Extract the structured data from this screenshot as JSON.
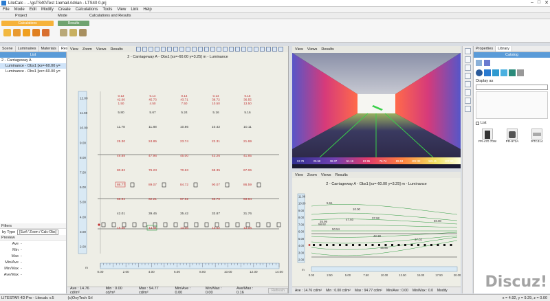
{
  "window": {
    "title": "LiteCalc - ...\\gsTS40\\Test 1\\email Adrian - LTS40 0.prj",
    "min": "–",
    "max": "□",
    "close": "✕"
  },
  "menu": [
    "File",
    "Mode",
    "Edit",
    "Modify",
    "Create",
    "Calculations",
    "Tools",
    "View",
    "Link",
    "Help"
  ],
  "ribbon_tabs": {
    "project": "Project",
    "mode": "Mode",
    "calc": "Calculations and Results"
  },
  "ribbon_groups": {
    "calculations": "Calculations",
    "results": "Results"
  },
  "left_panel": {
    "tabs": [
      "Scene",
      "Luminaires",
      "Materials",
      "Results"
    ],
    "list_header": "List",
    "tree": [
      "2 - Carriageway A",
      "Luminance - Obs1 [xs=-60.00 y=",
      "Luminance - Obs1 [xs=-60.00 y="
    ],
    "filters_title": "Filters",
    "filter_label": "by Type",
    "filter_value": "[Surf / Zoom / Calc-Obs]",
    "preview_title": "Preview",
    "preview_rows": [
      {
        "k": "Ave",
        "v": "-"
      },
      {
        "k": "Min",
        "v": "-"
      },
      {
        "k": "Max",
        "v": "-"
      },
      {
        "k": "Min/Ave",
        "v": "-"
      },
      {
        "k": "Min/Max",
        "v": "-"
      },
      {
        "k": "Ave/Max",
        "v": "-"
      }
    ]
  },
  "mid_pane": {
    "menu": [
      "View",
      "Zoom",
      "Views",
      "Results"
    ],
    "title": "2 - Carriageway A - Obs1 [xs=-60.00 y=3.25] m - Luminance",
    "y_axis": [
      "12.00",
      "11.00",
      "10.00",
      "9.00",
      "8.00",
      "7.00",
      "6.00",
      "5.00",
      "4.00",
      "3.00",
      "2.00"
    ],
    "x_axis": [
      "0.00",
      "2.00",
      "4.00",
      "6.00",
      "8.00",
      "10.00",
      "12.00",
      "14.00"
    ],
    "x_unit": "m",
    "column_heads": [
      [
        "0.13",
        "42.60",
        "1.50"
      ],
      [
        "0.14",
        "45.73",
        "4.50"
      ],
      [
        "0.14",
        "43.71",
        "7.50"
      ],
      [
        "0.14",
        "38.72",
        "10.50"
      ],
      [
        "0.15",
        "36.55",
        "13.50"
      ]
    ],
    "rows": [
      {
        "c": "#333",
        "v": [
          "5.80",
          "5.67",
          "5.24",
          "5.16",
          "5.16"
        ]
      },
      {
        "c": "#333",
        "v": [
          "11.78",
          "11.88",
          "10.86",
          "10.42",
          "10.11"
        ]
      },
      {
        "c": "#c03030",
        "v": [
          "25.30",
          "24.85",
          "23.74",
          "22.31",
          "21.69"
        ]
      },
      {
        "c": "#c03030",
        "v": [
          "49.88",
          "47.96",
          "45.00",
          "43.26",
          "41.85"
        ]
      },
      {
        "c": "#c03030",
        "v": [
          "80.82",
          "76.23",
          "70.63",
          "68.35",
          "67.06"
        ]
      },
      {
        "c": "#c03030",
        "v": [
          "86.77",
          "89.07",
          "84.72",
          "90.07",
          "86.59"
        ]
      },
      {
        "c": "#c03030",
        "v": [
          "66.94",
          "62.21",
          "57.92",
          "55.70",
          "53.84"
        ]
      },
      {
        "c": "#333",
        "v": [
          "42.01",
          "39.45",
          "35.42",
          "33.87",
          "31.76"
        ]
      },
      {
        "c": "#c03030",
        "v": [
          "15.50",
          "14.51",
          "14.06",
          "13.52",
          "13.05"
        ]
      }
    ],
    "status": [
      "Ave : 14.76 cd/m²",
      "Min : 0.00 cd/m²",
      "Max : 94.77 cd/m²",
      "Min/Ave : 0.00",
      "Min/Max : 0.00",
      "Ave/Max : 0.16"
    ],
    "status_btn": "Refresh"
  },
  "render_pane": {
    "menu": [
      "View",
      "Views",
      "Results"
    ],
    "scale": [
      "12.79",
      "25.58",
      "38.37",
      "51.16",
      "63.95",
      "76.74",
      "89.53",
      "102.32",
      "115.11",
      "127.90"
    ]
  },
  "lum_pane": {
    "menu": [
      "View",
      "Zoom",
      "Views",
      "Results"
    ],
    "title": "2 - Carriageway A - Obs1 [xs=-60.00 y=3.25] m - Luminance",
    "x_axis": [
      "0.00",
      "2.50",
      "5.00",
      "7.50",
      "10.00",
      "12.50",
      "15.00",
      "17.50",
      "20.00"
    ],
    "y_axis": [
      "11.00",
      "10.00",
      "9.00",
      "8.00",
      "7.00",
      "6.00",
      "5.00",
      "4.00",
      "3.00",
      "2.00"
    ],
    "x_unit": "m",
    "labels": [
      "5.61",
      "10.00",
      "37.92",
      "47.93",
      "35.99",
      "50.80",
      "58.92",
      "50.54",
      "42.38",
      "37.02",
      "15.95"
    ],
    "status": [
      "Ave : 14.76 cd/m²",
      "Min : 0.00 cd/m²",
      "Max : 94.77 cd/m²",
      "Min/Ave : 0.00",
      "Min/Max : 0.0",
      "Modify"
    ]
  },
  "right_panel": {
    "tabs": [
      "Properties",
      "Library"
    ],
    "header": "Catalog",
    "display_as": "Display as",
    "list_label": "List",
    "items": [
      "PR-470 70W",
      "PR-972A",
      "RTC414"
    ]
  },
  "footer": {
    "left": "LITESTAR 4D Pro - Litecalc v.5",
    "mid": "(c)OxyTech Srl",
    "coords": "x = 4.92, y = 9.29, z = 0.00"
  },
  "watermark": "Discuz!",
  "colors": {
    "accent": "#5a9bd8",
    "calc_orange": "#f6b23a",
    "results_green": "#6fa36f",
    "grid_green": "#2d9a3e"
  }
}
